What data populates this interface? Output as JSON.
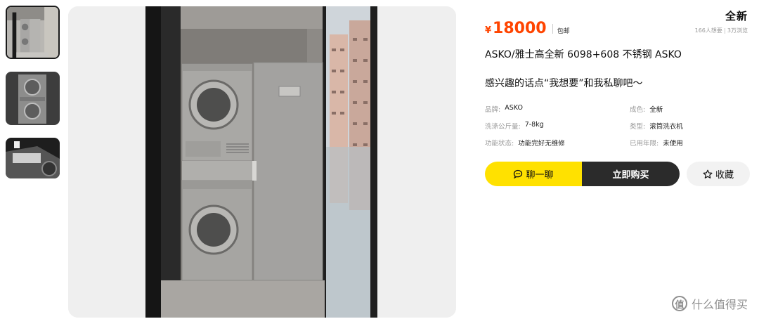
{
  "thumbnails": [
    {
      "alt": "thumbnail-1"
    },
    {
      "alt": "thumbnail-2"
    },
    {
      "alt": "thumbnail-3"
    }
  ],
  "condition_badge": "全新",
  "price": {
    "symbol": "¥",
    "value": "18000",
    "shipping": "包邮"
  },
  "stats": {
    "wants": "166人想要",
    "views": "3万浏览"
  },
  "title": "ASKO/雅士高全新 6098+608 不锈钢 ASKO",
  "description": "感兴趣的话点“我想要”和我私聊吧～",
  "specs": [
    {
      "label": "品牌:",
      "value": "ASKO"
    },
    {
      "label": "成色:",
      "value": "全新"
    },
    {
      "label": "洗涤公斤量:",
      "value": "7-8kg"
    },
    {
      "label": "类型:",
      "value": "滚筒洗衣机"
    },
    {
      "label": "功能状态:",
      "value": "功能完好无维修"
    },
    {
      "label": "已用年限:",
      "value": "未使用"
    }
  ],
  "actions": {
    "chat_label": "聊一聊",
    "buy_label": "立即购买",
    "favorite_label": "收藏"
  },
  "watermark": {
    "logo_char": "值",
    "text": "什么值得买"
  },
  "colors": {
    "price": "#ff4400",
    "accent_yellow": "#ffe100",
    "buy_button": "#2b2b2b"
  }
}
